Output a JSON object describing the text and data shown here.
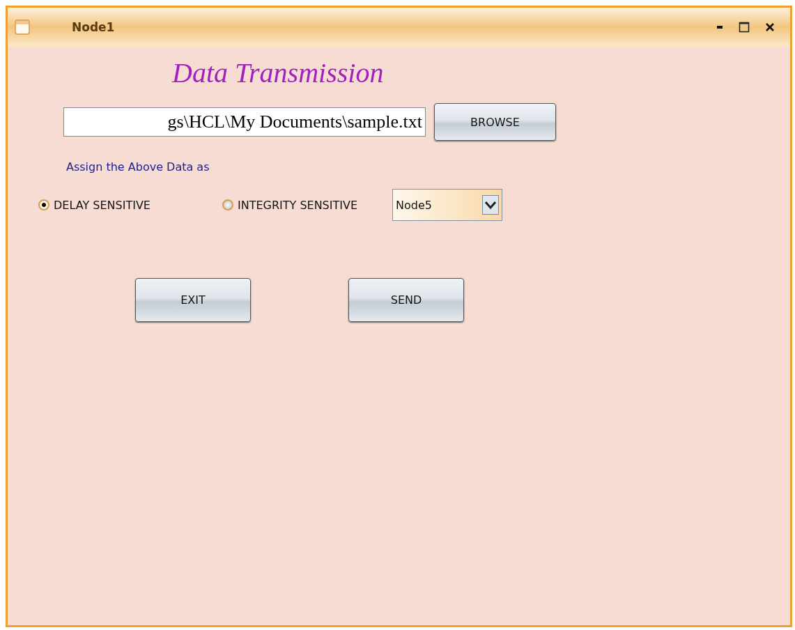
{
  "window": {
    "title": "Node1"
  },
  "heading": "Data Transmission",
  "file_field": {
    "value": "gs\\HCL\\My Documents\\sample.txt"
  },
  "browse_button": "BROWSE",
  "assign_label": "Assign the Above Data as",
  "radios": [
    {
      "label": "DELAY SENSITIVE",
      "selected": true
    },
    {
      "label": "INTEGRITY SENSITIVE",
      "selected": false
    }
  ],
  "node_dropdown": {
    "value": "Node5"
  },
  "buttons": [
    "EXIT",
    "SEND"
  ]
}
